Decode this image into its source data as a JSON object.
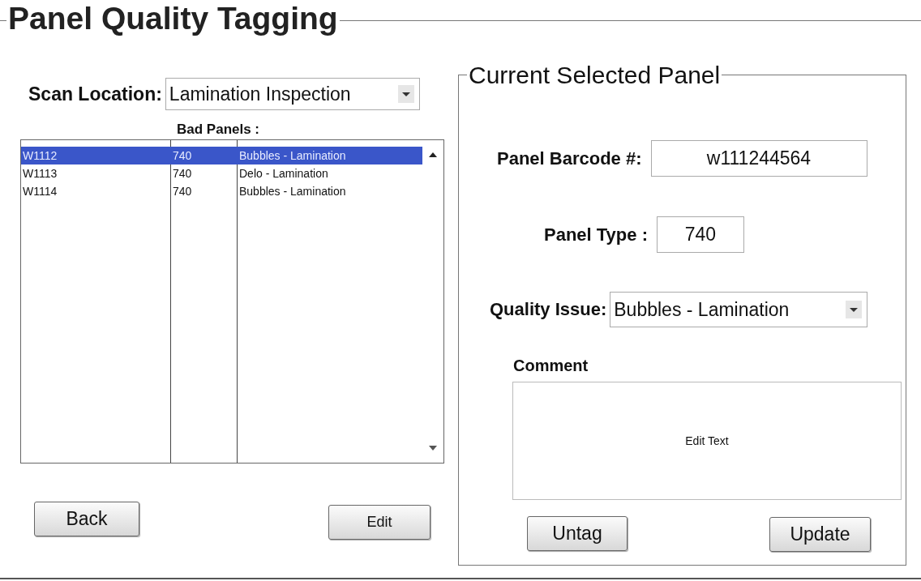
{
  "title": "Panel Quality Tagging",
  "scan_location": {
    "label": "Scan Location:",
    "value": "Lamination Inspection"
  },
  "bad_panels": {
    "title": "Bad Panels :",
    "rows": [
      {
        "cells": [
          "W1112",
          "740",
          "Bubbles - Lamination"
        ],
        "selected": true
      },
      {
        "cells": [
          "W1113",
          "740",
          "Delo -  Lamination"
        ],
        "selected": false
      },
      {
        "cells": [
          "W1114",
          "740",
          "Bubbles - Lamination"
        ],
        "selected": false
      }
    ]
  },
  "left_buttons": [
    "Back",
    "Edit"
  ],
  "current_panel": {
    "title": "Current Selected Panel",
    "barcode": {
      "label": "Panel Barcode #:",
      "value": "w111244564"
    },
    "panel_type": {
      "label": "Panel Type :",
      "value": "740"
    },
    "quality_issue": {
      "label": "Quality Issue:",
      "value": "Bubbles - Lamination"
    },
    "comment": {
      "label": "Comment",
      "value": "Edit Text"
    },
    "buttons": [
      "Untag",
      "Update"
    ]
  }
}
